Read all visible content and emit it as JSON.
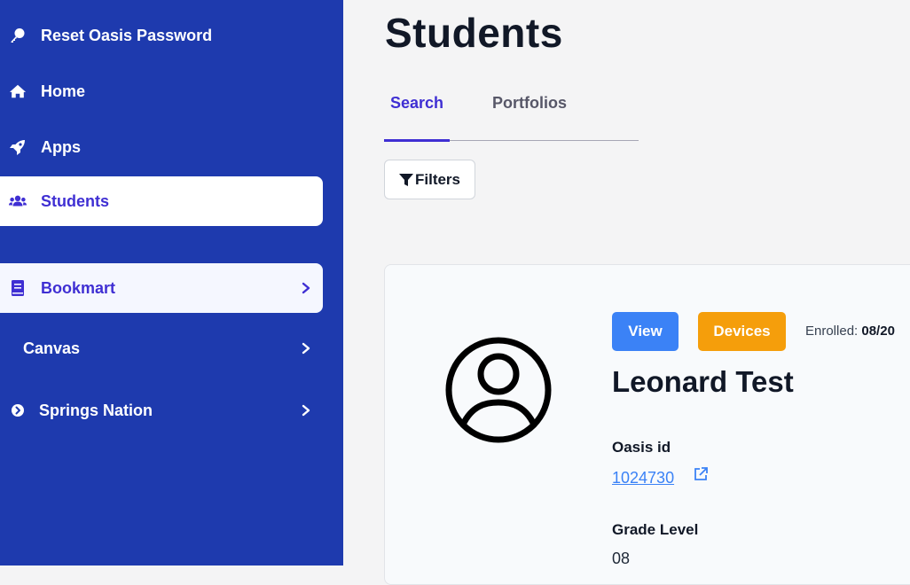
{
  "sidebar": {
    "items": [
      {
        "label": "Reset Oasis Password",
        "icon": "key-icon"
      },
      {
        "label": "Home",
        "icon": "home-icon"
      },
      {
        "label": "Apps",
        "icon": "rocket-icon"
      },
      {
        "label": "Students",
        "icon": "users-icon",
        "active": true
      },
      {
        "label": "Bookmart",
        "icon": "book-icon",
        "has_submenu": true
      },
      {
        "label": "Canvas",
        "has_submenu": true
      },
      {
        "label": "Springs Nation",
        "icon": "arrow-circle-icon",
        "has_submenu": true
      }
    ]
  },
  "main": {
    "title": "Students",
    "tabs": [
      {
        "label": "Search",
        "active": true
      },
      {
        "label": "Portfolios"
      }
    ],
    "filters_label": "Filters"
  },
  "student_card": {
    "view_label": "View",
    "devices_label": "Devices",
    "enrolled_label": "Enrolled:",
    "enrolled_value": "08/20",
    "name": "Leonard Test",
    "oasis_id_label": "Oasis id",
    "oasis_id_value": "1024730",
    "grade_level_label": "Grade Level",
    "grade_level_value": "08"
  },
  "colors": {
    "sidebar_bg": "#1e3aae",
    "accent": "#3f2fd3",
    "view_badge": "#3b82f6",
    "devices_badge": "#f59e0b"
  }
}
